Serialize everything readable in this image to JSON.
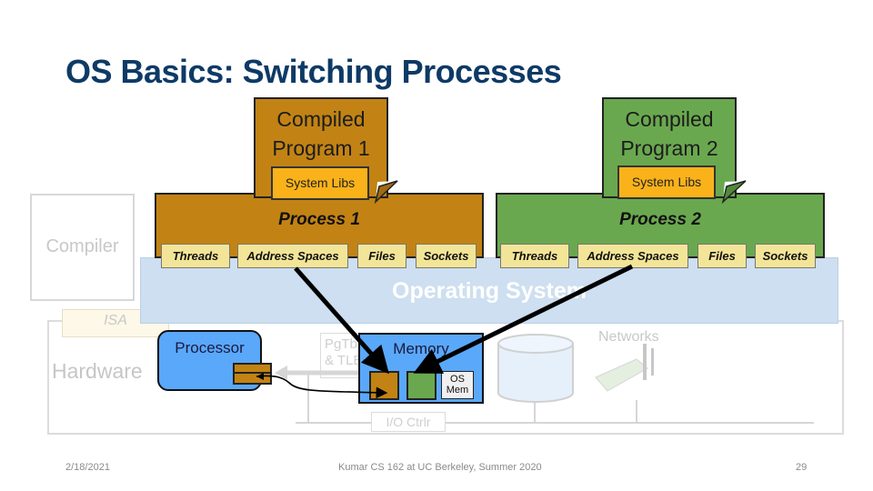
{
  "slide": {
    "title": "OS Basics: Switching Processes",
    "footer": {
      "date": "2/18/2021",
      "course": "Kumar CS 162 at UC Berkeley, Summer 2020",
      "page_number": "29"
    }
  },
  "background_layers": {
    "compiler": "Compiler",
    "isa": "ISA",
    "hardware": "Hardware",
    "operating_system": "Operating System"
  },
  "programs": [
    {
      "title_line1": "Compiled",
      "title_line2": "Program 1",
      "libs": "System Libs",
      "color": "#c28314"
    },
    {
      "title_line1": "Compiled",
      "title_line2": "Program 2",
      "libs": "System Libs",
      "color": "#6aa84f"
    }
  ],
  "processes": [
    {
      "label": "Process 1",
      "color": "#c28314",
      "resources": [
        "Threads",
        "Address Spaces",
        "Files",
        "Sockets"
      ]
    },
    {
      "label": "Process 2",
      "color": "#6aa84f",
      "resources": [
        "Threads",
        "Address Spaces",
        "Files",
        "Sockets"
      ]
    }
  ],
  "hardware": {
    "processor": "Processor",
    "page_table_line1": "PgTbl",
    "page_table_line2": "& TLB",
    "memory": "Memory",
    "os_mem_line1": "OS",
    "os_mem_line2": "Mem",
    "storage": "Storage",
    "networks": "Networks",
    "io_controller": "I/O Ctrlr"
  },
  "icons": {
    "storage": "cylinder-disk-icon",
    "network": "network-card-icon",
    "page_fold": "page-curl-icon"
  }
}
